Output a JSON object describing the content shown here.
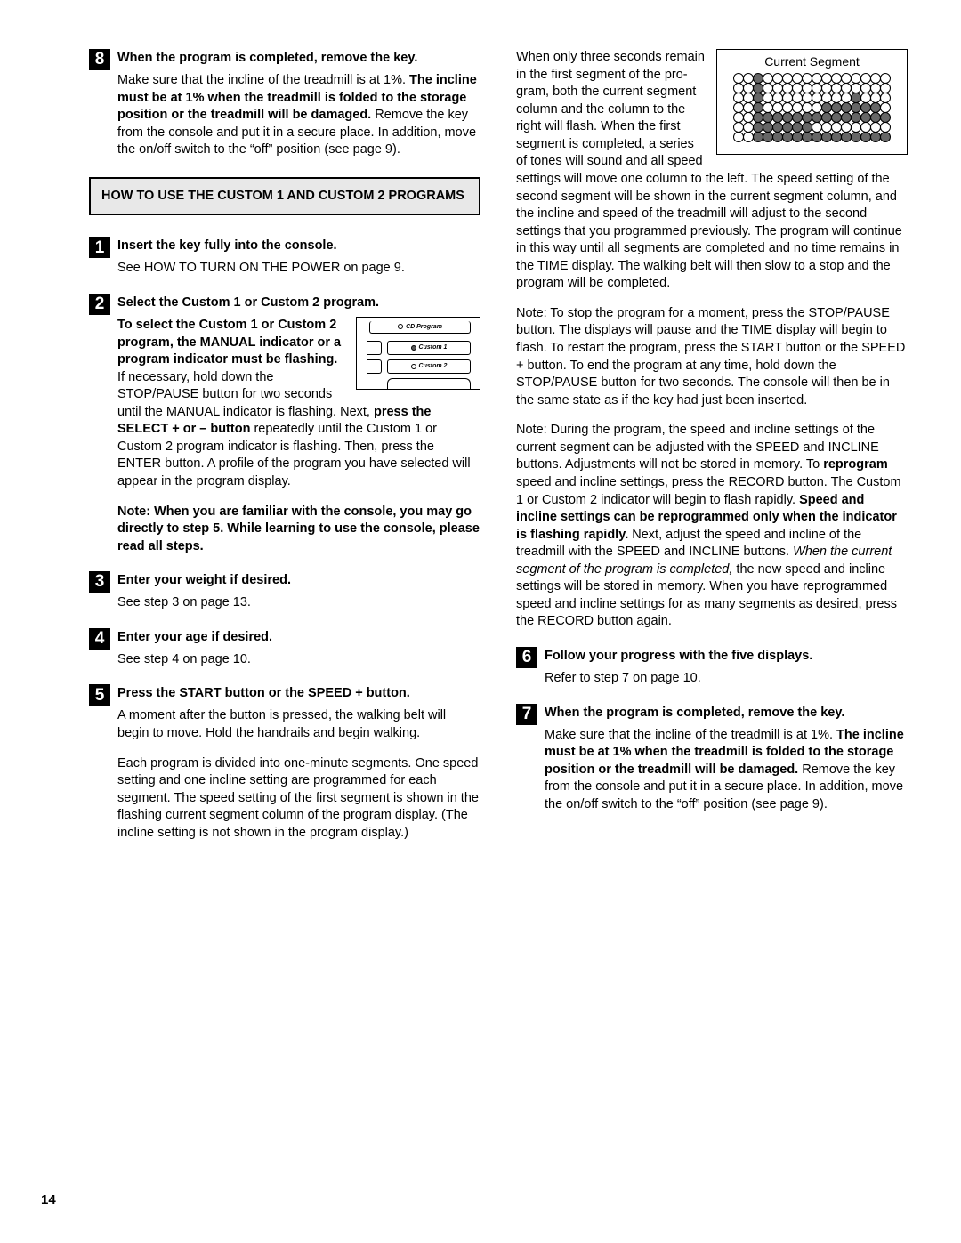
{
  "page_number": "14",
  "left": {
    "step8": {
      "num": "8",
      "title": "When the program is completed, remove the key.",
      "p1a": "Make sure that the incline of the treadmill is at 1%. ",
      "p1b": "The incline must be at 1% when the treadmill is folded to the storage position or the treadmill will be damaged.",
      "p1c": " Remove the key from the con­sole and put it in a secure place. In addition, move the on/off switch to the “off” position (see page 9)."
    },
    "heading": "HOW TO USE THE CUSTOM 1 AND CUSTOM 2 PROGRAMS",
    "step1": {
      "num": "1",
      "title": "Insert the key fully into the console.",
      "p1": "See HOW TO TURN ON THE POWER on page 9."
    },
    "step2": {
      "num": "2",
      "title": "Select the Custom 1 or Custom 2  program.",
      "console": {
        "top": "CD Program",
        "c1": "Custom 1",
        "c2": "Custom 2"
      },
      "p1a": "To select the Custom 1 or Custom 2 program, the MANUAL indicator or a program indicator must be flashing.",
      "p1b": " If nec­essary, hold down the STOP/PAUSE button for two seconds until the MANUAL indicator is flashing. Next, ",
      "p1c": "press the SELECT + or – button",
      "p1d": " repeatedly until the Custom 1 or Custom 2 program indicator is flashing. Then, press the ENTER button. A profile of the program you have selected will appear in the program display.",
      "p2": "Note: When you are familiar with the console, you may go directly to step 5. While learning to use the console, please read all steps."
    },
    "step3": {
      "num": "3",
      "title": "Enter your weight if desired.",
      "p1": "See step 3 on page 13."
    },
    "step4": {
      "num": "4",
      "title": "Enter your age if desired.",
      "p1": "See step 4 on page 10."
    },
    "step5": {
      "num": "5",
      "title": "Press the START button or the SPEED + button.",
      "p1": "A moment after the button is pressed, the walking belt will begin to move. Hold the handrails and begin walking.",
      "p2": "Each program is divided into one-minute segments. One speed setting and one incline setting are pro­grammed for each segment. The speed setting of the first segment is shown in the flashing current segment column of the program display. (The in­cline setting is not shown in the program display.)"
    }
  },
  "right": {
    "segment_title": "Current Segment",
    "p1": "When only three seconds remain in the first seg­ment of the pro­gram, both the current segment column and the column to the right will flash. When the first segment is com­pleted, a series of tones will sound and all speed settings will move one column to the left. The speed setting of the second segment will be shown in the current segment column, and the incline and speed of the treadmill will adjust to the second settings that you programmed previously. The program will continue in this way until all seg­ments are completed and no time remains in the TIME display. The walking belt will then slow to a stop and the program will be completed.",
    "p2": "Note: To stop the program for a moment, press the STOP/PAUSE button. The displays will pause and the TIME display will begin to flash. To restart the program, press the START button or the SPEED + button. To end the program at any time, hold down the STOP/PAUSE button for two seconds. The console will then be in the same state as if the key had just been inserted.",
    "p3a": "Note: During the program, the speed and incline settings of the current segment can be adjusted with the SPEED and INCLINE buttons. Adjustments will not be stored in memory. To ",
    "p3b": "reprogram",
    "p3c": " speed and incline settings, press the RECORD button. The Custom 1 or Custom 2 indicator will begin to flash rapidly. ",
    "p3d": "Speed and incline settings can be reprogrammed only when the indicator is flash­ing rapidly.",
    "p3e": " Next, adjust the speed and incline of the treadmill with the SPEED and INCLINE buttons. ",
    "p3f": "When the current segment of the program is com­pleted,",
    "p3g": " the new speed and incline settings will be stored in memory. When you have reprogrammed speed and incline settings for as many segments as desired, press the RECORD button again.",
    "step6": {
      "num": "6",
      "title": "Follow your progress with the five displays.",
      "p1": "Refer to step 7 on page 10."
    },
    "step7": {
      "num": "7",
      "title": "When the program is completed, remove the key.",
      "p1a": "Make sure that the incline of the treadmill is at 1%. ",
      "p1b": "The incline must be at 1% when the treadmill is folded to the storage position or the treadmill will be damaged.",
      "p1c": " Remove the key from the con­sole and put it in a secure place. In addition, move the on/off switch to the “off” position (see page 9)."
    }
  }
}
